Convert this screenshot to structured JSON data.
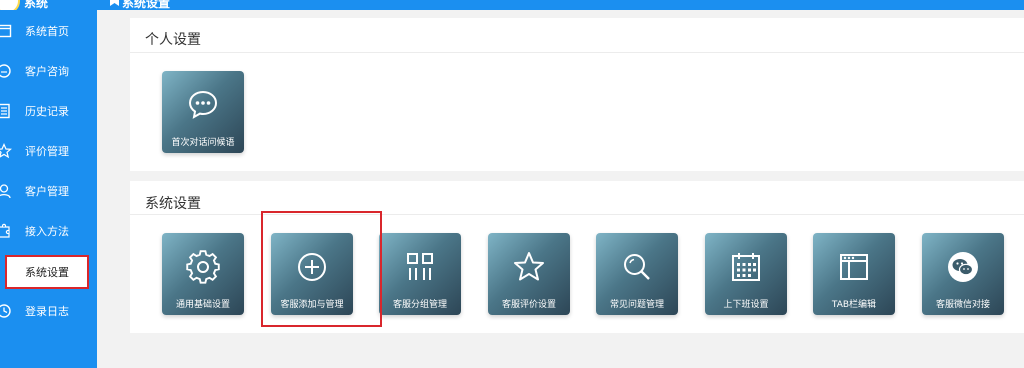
{
  "app": {
    "logo_text": "系统",
    "breadcrumb": "系统设置"
  },
  "colors": {
    "sidebar_bg": "#1b8ff0",
    "highlight": "#d9262c",
    "tile_dark": "#2d4656"
  },
  "sidebar": {
    "items": [
      {
        "label": "系统首页",
        "icon": "window-icon"
      },
      {
        "label": "客户咨询",
        "icon": "chat-bubble-icon"
      },
      {
        "label": "历史记录",
        "icon": "notebook-icon"
      },
      {
        "label": "评价管理",
        "icon": "star-icon"
      },
      {
        "label": "客户管理",
        "icon": "user-icon"
      },
      {
        "label": "接入方法",
        "icon": "puzzle-icon"
      },
      {
        "label": "系统设置",
        "icon": "",
        "active": true
      },
      {
        "label": "登录日志",
        "icon": "clock-icon"
      }
    ]
  },
  "personal_panel": {
    "title": "个人设置",
    "tiles": [
      {
        "label": "首次对话问候语",
        "icon": "chat-dots-icon"
      }
    ]
  },
  "system_panel": {
    "title": "系统设置",
    "tiles": [
      {
        "label": "通用基础设置",
        "icon": "gear-icon"
      },
      {
        "label": "客服添加与管理",
        "icon": "plus-circle-icon"
      },
      {
        "label": "客服分组管理",
        "icon": "grid-icon"
      },
      {
        "label": "客服评价设置",
        "icon": "star-icon"
      },
      {
        "label": "常见问题管理",
        "icon": "search-icon"
      },
      {
        "label": "上下班设置",
        "icon": "calendar-icon"
      },
      {
        "label": "TAB栏编辑",
        "icon": "browser-window-icon"
      },
      {
        "label": "客服微信对接",
        "icon": "wechat-icon"
      }
    ]
  }
}
